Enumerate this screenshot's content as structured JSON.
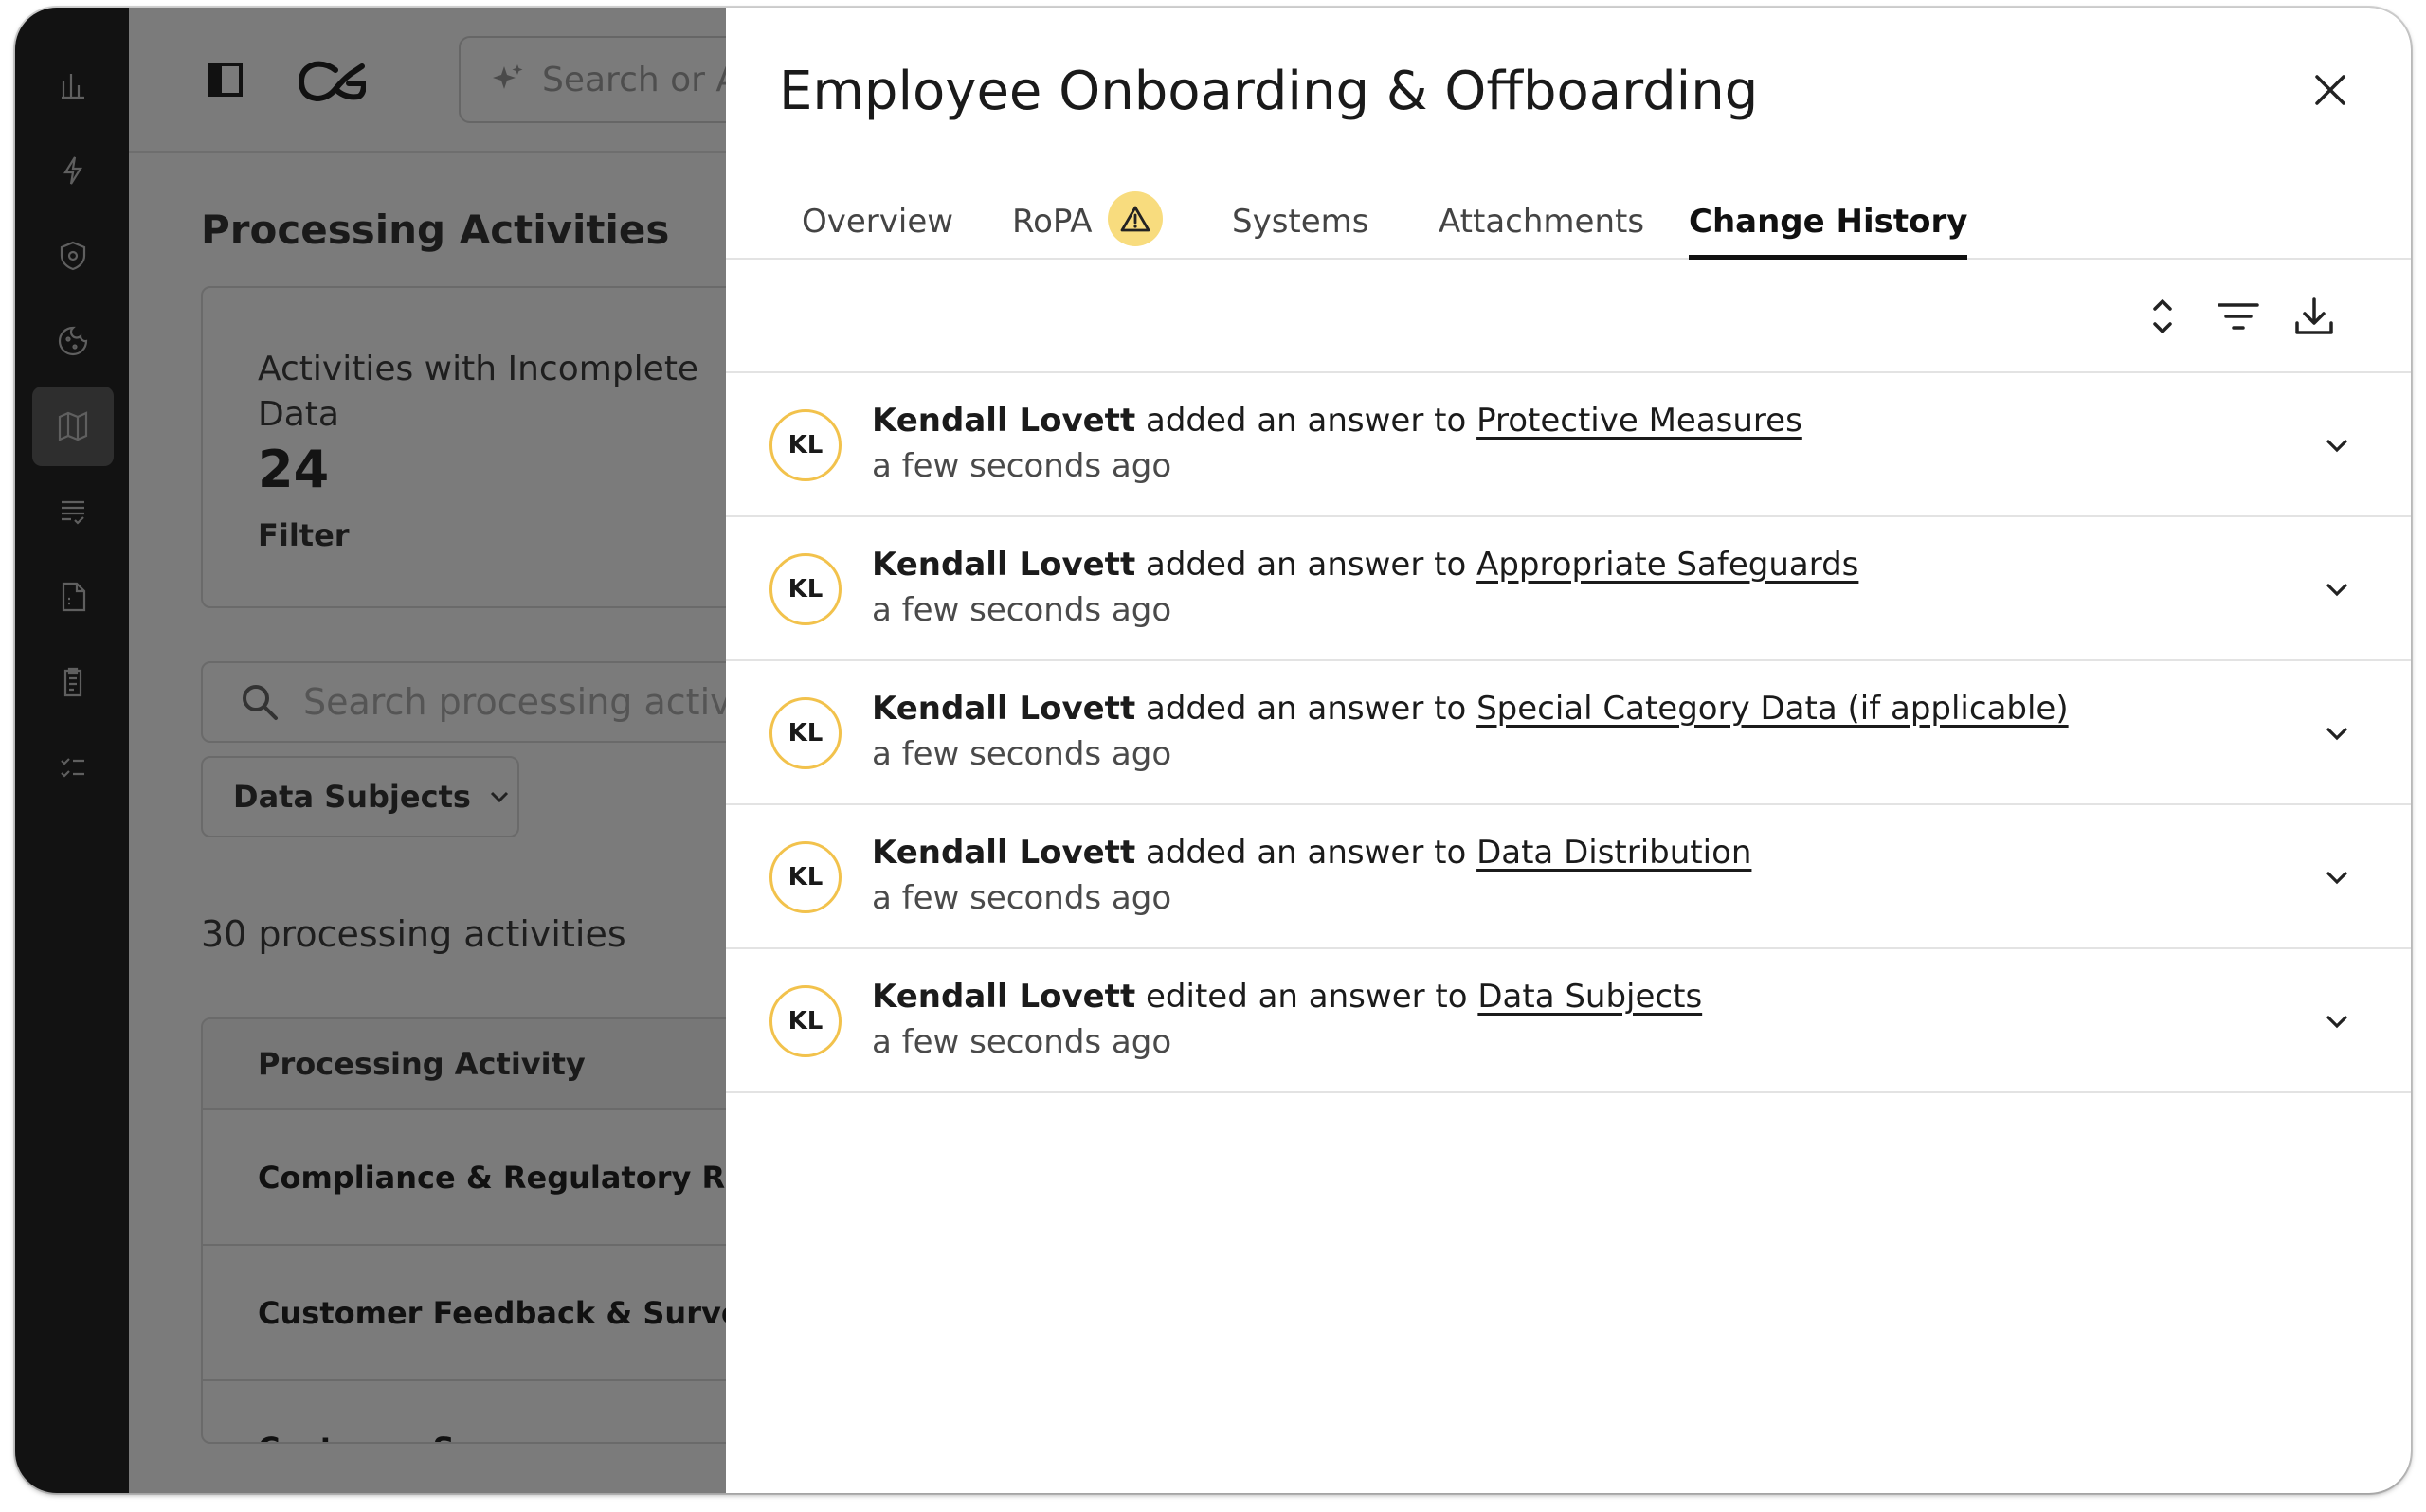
{
  "app": {
    "ai_search_placeholder": "Search or A",
    "page_title": "Processing Activities",
    "stat_card": {
      "label": "Activities with Incomplete Data",
      "value": "24",
      "filter_label": "Filter"
    },
    "search_placeholder": "Search processing activiti",
    "filter_button_label": "Data Subjects",
    "count_label": "30 processing activities",
    "table": {
      "header": "Processing Activity",
      "rows": [
        "Compliance & Regulatory Repo",
        "Customer Feedback & Surveys",
        "Customer S"
      ]
    }
  },
  "sidebar_icons": [
    "bar-chart-icon",
    "lightning-icon",
    "shield-icon",
    "cookie-icon",
    "map-icon",
    "list-check-icon",
    "document-icon",
    "clipboard-icon",
    "checklist-icon"
  ],
  "drawer": {
    "title": "Employee Onboarding & Offboarding",
    "tabs": [
      {
        "label": "Overview",
        "active": false
      },
      {
        "label": "RoPA",
        "active": false,
        "badge": "warning-icon"
      },
      {
        "label": "Systems",
        "active": false
      },
      {
        "label": "Attachments",
        "active": false
      },
      {
        "label": "Change History",
        "active": true
      }
    ],
    "history": [
      {
        "initials": "KL",
        "user": "Kendall Lovett",
        "action": "added an answer to",
        "target": "Protective Measures",
        "time": "a few seconds ago"
      },
      {
        "initials": "KL",
        "user": "Kendall Lovett",
        "action": "added an answer to",
        "target": "Appropriate Safeguards",
        "time": "a few seconds ago"
      },
      {
        "initials": "KL",
        "user": "Kendall Lovett",
        "action": "added an answer to",
        "target": "Special Category Data (if applicable)",
        "time": "a few seconds ago"
      },
      {
        "initials": "KL",
        "user": "Kendall Lovett",
        "action": "added an answer to",
        "target": "Data Distribution",
        "time": "a few seconds ago"
      },
      {
        "initials": "KL",
        "user": "Kendall Lovett",
        "action": "edited an answer to",
        "target": "Data Subjects",
        "time": "a few seconds ago"
      }
    ]
  },
  "colors": {
    "badge_warning": "#f8dc7e",
    "avatar_border": "#f2c24c",
    "sidebar_bg": "#121212",
    "overlay_bg": "#7b7b7b"
  }
}
